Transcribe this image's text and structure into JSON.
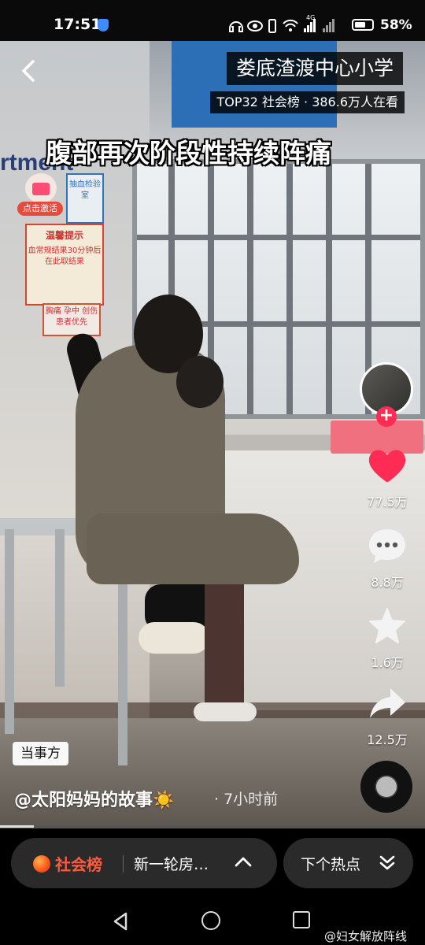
{
  "status_bar": {
    "time": "17:51",
    "icons": [
      "headphones-icon",
      "eye-icon",
      "vibrate-icon",
      "wifi-icon",
      "signal-icon",
      "signal-icon"
    ],
    "network": "4G",
    "battery_percent": "58%"
  },
  "video": {
    "title_tag": "娄底渣渡中心小学",
    "rank_tag": "TOP32 社会榜 · 386.6万人在看",
    "caption": "腹部再次阶段性持续阵痛",
    "activate_label": "点击激活",
    "wall_text": "rtment",
    "poster_title": "温馨提示",
    "poster_body": "血常规结果30分钟后在此取结果",
    "poster2_body": "胸痛 孕中 创伤 患者优先",
    "poster0_text": "抽血检验室",
    "party_tag": "当事方",
    "author": "@太阳妈妈的故事",
    "author_emoji": "☀️",
    "posted": "· 7小时前",
    "progress": 0.08
  },
  "actions": [
    {
      "name": "like",
      "count": "77.5万",
      "icon": "heart-icon",
      "color": "#fe2c55"
    },
    {
      "name": "comment",
      "count": "8.8万",
      "icon": "comment-icon"
    },
    {
      "name": "favorite",
      "count": "1.6万",
      "icon": "star-icon"
    },
    {
      "name": "share",
      "count": "12.5万",
      "icon": "share-icon"
    }
  ],
  "hot_bar": {
    "label": "社会榜",
    "topic": "新一轮房…",
    "next_label": "下个热点"
  },
  "watermark": "@妇女解放阵线"
}
